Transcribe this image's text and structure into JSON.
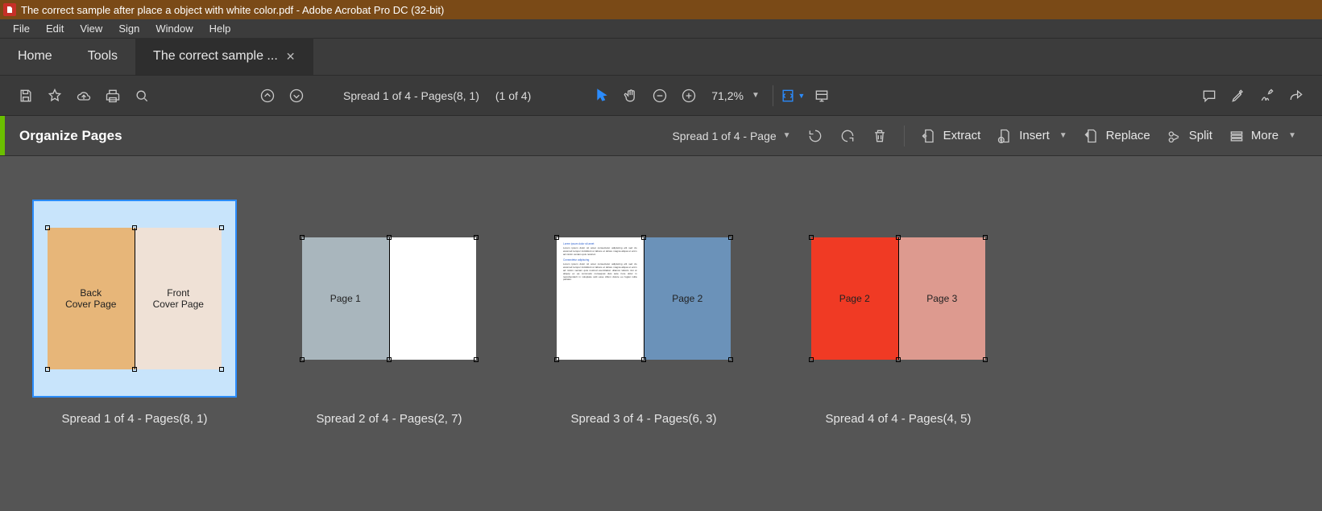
{
  "window": {
    "title": "The correct sample after place a object with white color.pdf - Adobe Acrobat Pro DC (32-bit)"
  },
  "menu": {
    "items": [
      "File",
      "Edit",
      "View",
      "Sign",
      "Window",
      "Help"
    ]
  },
  "tabs": {
    "home": "Home",
    "tools": "Tools",
    "doc": "The correct sample ..."
  },
  "toolbar": {
    "spread_label": "Spread 1 of 4 - Pages(8, 1)",
    "page_of": "(1 of 4)",
    "zoom": "71,2%"
  },
  "orgbar": {
    "title": "Organize Pages",
    "spread_dd": "Spread 1 of 4 - Page",
    "extract": "Extract",
    "insert": "Insert",
    "replace": "Replace",
    "split": "Split",
    "more": "More"
  },
  "spreads": [
    {
      "caption": "Spread 1 of 4 - Pages(8, 1)",
      "selected": true,
      "left": {
        "bg": "#e7b679",
        "text": "Back\nCover Page"
      },
      "right": {
        "bg": "#efe1d6",
        "text": "Front\nCover Page"
      }
    },
    {
      "caption": "Spread 2 of 4 - Pages(2, 7)",
      "selected": false,
      "left": {
        "bg": "#a9b6bd",
        "text": "Page 1"
      },
      "right": {
        "bg": "#ffffff",
        "text": ""
      }
    },
    {
      "caption": "Spread 3 of 4 - Pages(6, 3)",
      "selected": false,
      "left": {
        "bg": "#ffffff",
        "text": "",
        "doc": true
      },
      "right": {
        "bg": "#6b92b9",
        "text": "Page 2"
      }
    },
    {
      "caption": "Spread 4 of 4 - Pages(4, 5)",
      "selected": false,
      "left": {
        "bg": "#f03a24",
        "text": "Page 2"
      },
      "right": {
        "bg": "#dd9a8f",
        "text": "Page 3"
      }
    }
  ]
}
